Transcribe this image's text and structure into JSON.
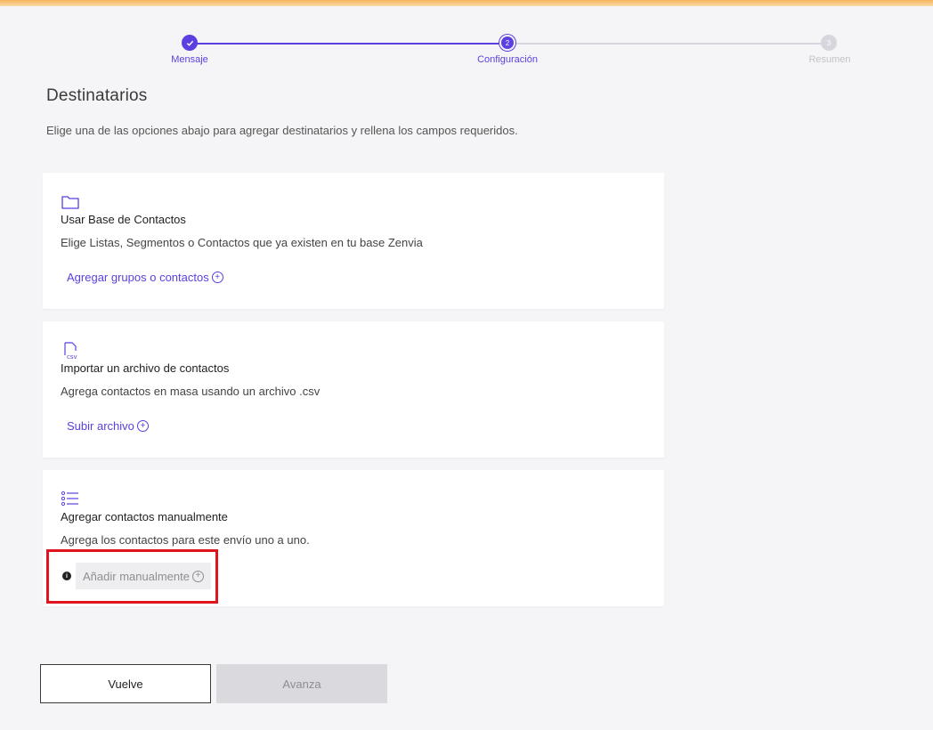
{
  "stepper": {
    "steps": [
      {
        "label": "Mensaje",
        "status": "done"
      },
      {
        "label": "Configuración",
        "status": "current",
        "number": "2"
      },
      {
        "label": "Resumen",
        "status": "pending",
        "number": "3"
      }
    ],
    "done_icon": "checkmark-icon"
  },
  "page": {
    "title": "Destinatarios",
    "subtitle": "Elige una de las opciones abajo para agregar destinatarios y rellena los campos requeridos."
  },
  "cards": [
    {
      "icon": "folder-icon",
      "title": "Usar Base de Contactos",
      "description": "Elige Listas, Segmentos o Contactos que ya existen en tu base Zenvia",
      "action": "Agregar grupos o contactos"
    },
    {
      "icon": "csv-file-icon",
      "title": "Importar un archivo de contactos",
      "description": "Agrega contactos en masa usando un archivo .csv",
      "action": "Subir archivo"
    },
    {
      "icon": "list-icon",
      "title": "Agregar contactos manualmente",
      "description": "Agrega los contactos para este envío uno a uno.",
      "action": "Añadir manualmente"
    }
  ],
  "footer": {
    "back_label": "Vuelve",
    "next_label": "Avanza"
  },
  "colors": {
    "accent": "#5b3fe0",
    "highlight": "#e0141e",
    "top_bar": "#f4b45a"
  }
}
